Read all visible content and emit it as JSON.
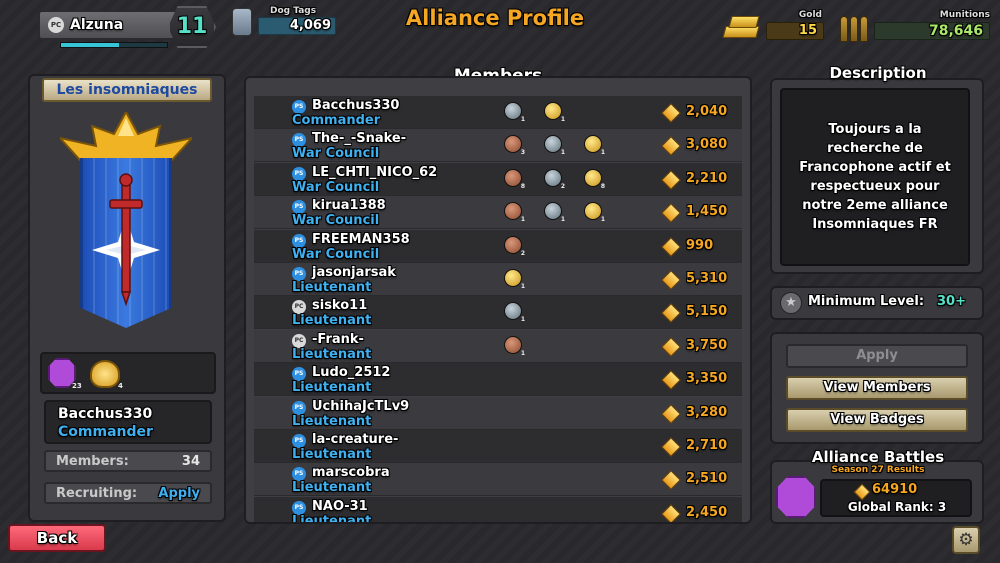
{
  "player": {
    "name": "Alzuna",
    "platform": "PC",
    "level": "11",
    "xp_fraction": 0.55
  },
  "currencies": {
    "dog_tags_label": "Dog Tags",
    "dog_tags": "4,069",
    "gold_label": "Gold",
    "gold": "15",
    "munitions_label": "Munitions",
    "munitions": "78,646"
  },
  "page_title": "Alliance Profile",
  "alliance": {
    "name": "Les insomniaques",
    "badges": [
      {
        "icon": "purple-gem-icon",
        "count": "23"
      },
      {
        "icon": "gold-shield-icon",
        "count": "4"
      }
    ],
    "leader_name": "Bacchus330",
    "leader_role": "Commander",
    "members_label": "Members:",
    "members_count": "34",
    "recruiting_label": "Recruiting:",
    "recruiting_value": "Apply"
  },
  "members_title": "Members",
  "members": [
    {
      "name": "Bacchus330",
      "role": "Commander",
      "platform": "PS",
      "medals": [
        {
          "type": "silver",
          "count": "1"
        },
        {
          "type": "gold",
          "count": "1"
        }
      ],
      "score": "2,040"
    },
    {
      "name": "The-_-Snake-",
      "role": "War Council",
      "platform": "PS",
      "medals": [
        {
          "type": "bronze",
          "count": "3"
        },
        {
          "type": "silver",
          "count": "1"
        },
        {
          "type": "gold",
          "count": "1"
        }
      ],
      "score": "3,080"
    },
    {
      "name": "LE_CHTI_NICO_62",
      "role": "War Council",
      "platform": "PS",
      "medals": [
        {
          "type": "bronze",
          "count": "8"
        },
        {
          "type": "silver",
          "count": "2"
        },
        {
          "type": "gold",
          "count": "8"
        }
      ],
      "score": "2,210"
    },
    {
      "name": "kirua1388",
      "role": "War Council",
      "platform": "PS",
      "medals": [
        {
          "type": "bronze",
          "count": "1"
        },
        {
          "type": "silver",
          "count": "1"
        },
        {
          "type": "gold",
          "count": "1"
        }
      ],
      "score": "1,450"
    },
    {
      "name": "FREEMAN358",
      "role": "War Council",
      "platform": "PS",
      "medals": [
        {
          "type": "bronze",
          "count": "2"
        }
      ],
      "score": "990"
    },
    {
      "name": "jasonjarsak",
      "role": "Lieutenant",
      "platform": "PS",
      "medals": [
        {
          "type": "gold",
          "count": "1"
        }
      ],
      "score": "5,310"
    },
    {
      "name": "sisko11",
      "role": "Lieutenant",
      "platform": "PC",
      "medals": [
        {
          "type": "silver",
          "count": "1"
        }
      ],
      "score": "5,150"
    },
    {
      "name": "-Frank-",
      "role": "Lieutenant",
      "platform": "PC",
      "medals": [
        {
          "type": "bronze",
          "count": "1"
        }
      ],
      "score": "3,750"
    },
    {
      "name": "Ludo_2512",
      "role": "Lieutenant",
      "platform": "PS",
      "medals": [],
      "score": "3,350"
    },
    {
      "name": "UchihaJcTLv9",
      "role": "Lieutenant",
      "platform": "PS",
      "medals": [],
      "score": "3,280"
    },
    {
      "name": "la-creature-",
      "role": "Lieutenant",
      "platform": "PS",
      "medals": [],
      "score": "2,710"
    },
    {
      "name": "marscobra",
      "role": "Lieutenant",
      "platform": "PS",
      "medals": [],
      "score": "2,510"
    },
    {
      "name": "NAO-31",
      "role": "Lieutenant",
      "platform": "PS",
      "medals": [],
      "score": "2,450"
    }
  ],
  "description": {
    "title": "Description",
    "text": "Toujours a la recherche de Francophone actif et respectueux pour notre 2eme alliance Insomniaques FR"
  },
  "min_level": {
    "label": "Minimum Level:",
    "value": "30+"
  },
  "buttons": {
    "apply": "Apply",
    "view_members": "View Members",
    "view_badges": "View Badges",
    "back": "Back"
  },
  "battles": {
    "title": "Alliance Battles",
    "subtitle": "Season 27 Results",
    "score": "64910",
    "rank": "Global Rank: 3"
  },
  "colors": {
    "accent_orange": "#f5a623",
    "role_blue": "#3fb0f0",
    "teal": "#57e0c8",
    "back_red": "#e04a5a"
  }
}
